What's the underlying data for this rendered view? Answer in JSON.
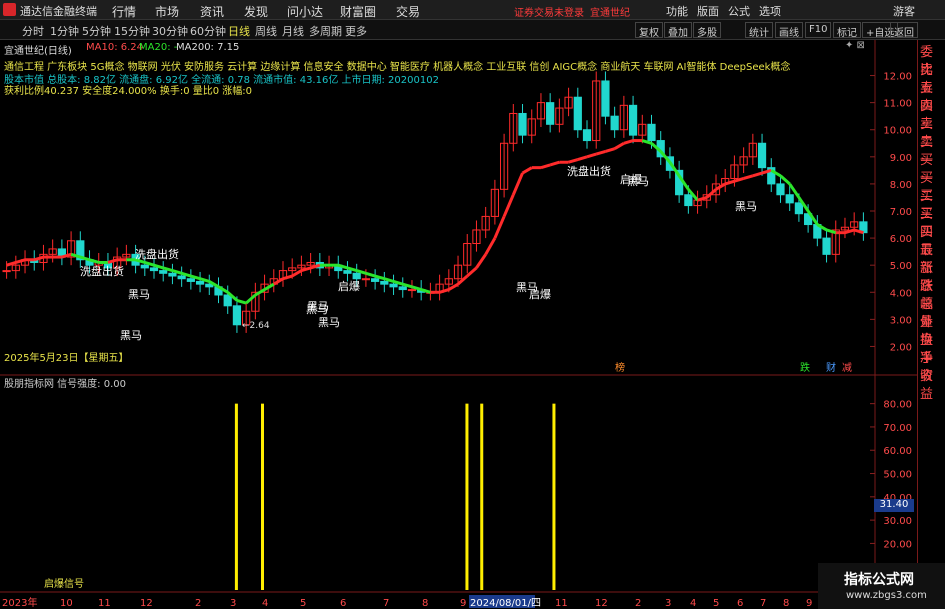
{
  "app": {
    "title": "通达信金融终端"
  },
  "menus": [
    "行情",
    "市场",
    "资讯",
    "发现",
    "问小达",
    "财富圈",
    "交易"
  ],
  "warning": "证券交易未登录",
  "warning2": "宜通世纪",
  "top_right_menus": [
    "功能",
    "版面",
    "公式",
    "选项",
    "游客"
  ],
  "periods": [
    "分时",
    "1分钟",
    "5分钟",
    "15分钟",
    "30分钟",
    "60分钟",
    "日线",
    "周线",
    "月线",
    "多周期",
    "更多"
  ],
  "active_period": "日线",
  "toolbar_right": [
    "复权",
    "叠加",
    "多股",
    "统计",
    "画线",
    "F10",
    "标记",
    "+自选",
    "返回"
  ],
  "info": {
    "stock": "宜通世纪(日线)",
    "ma10": "MA10: 6.24",
    "ma20": "MA20: -",
    "ma200": "MA200: 7.15"
  },
  "concepts": "通信工程  广东板块  5G概念 物联网 光伏 安防服务 云计算 边缘计算 信息安全 数据中心 智能医疗 机器人概念 工业互联 信创 AIGC概念 商业航天 车联网 AI智能体 DeepSeek概念",
  "stats1": "股本市值 总股本: 8.82亿 流通盘: 6.92亿 全流通: 0.78 流通市值: 43.16亿 上市日期: 20200102",
  "stats2": "获利比例40.237  安全度24.000%  换手:0    量比0       涨幅:0",
  "date_label": "2025年5月23日【星期五】",
  "indicator_label": "股朋指标网  信号强度: 0.00",
  "signal_title": "启爆信号",
  "right_box_value": "31.40",
  "side_panel": [
    "委比",
    "卖五",
    "卖四",
    "卖三",
    "卖二",
    "卖一",
    "买一",
    "买二",
    "买三",
    "买四",
    "买五",
    "最新",
    "涨跌",
    "涨幅",
    "总量",
    "外盘",
    "换手",
    "净资",
    "收益"
  ],
  "price_axis": [
    "12.00",
    "11.00",
    "10.00",
    "9.00",
    "8.00",
    "7.00",
    "6.00",
    "5.00",
    "4.00",
    "3.00",
    "2.00"
  ],
  "ind_axis": [
    "80.00",
    "70.00",
    "60.00",
    "50.00",
    "40.00",
    "30.00",
    "20.00",
    "10.00",
    "0.00"
  ],
  "x_axis_labels": [
    "2023年",
    "10",
    "11",
    "12",
    "2",
    "3",
    "4",
    "5",
    "6",
    "7",
    "8",
    "9",
    "2024/08/01/四",
    "11",
    "12",
    "2",
    "3",
    "4",
    "5",
    "6",
    "7",
    "8",
    "9",
    "10",
    "11",
    "12",
    "2",
    "3",
    "4",
    "5"
  ],
  "annotations": [
    {
      "text": "洗盘出货",
      "color": "#ffffff"
    },
    {
      "text": "洗盘出货",
      "color": "#ffffff"
    },
    {
      "text": "黑马",
      "color": "#ffffff"
    },
    {
      "text": "黑马",
      "color": "#ffffff"
    },
    {
      "text": "黑马",
      "color": "#ffffff"
    },
    {
      "text": "黑马",
      "color": "#ffffff"
    },
    {
      "text": "黑马",
      "color": "#ffffff"
    },
    {
      "text": "黑马",
      "color": "#ffffff"
    },
    {
      "text": "启爆",
      "color": "#ffffff"
    },
    {
      "text": "启爆",
      "color": "#ffffff"
    },
    {
      "text": "洗盘出货",
      "color": "#ffffff"
    },
    {
      "text": "黑马",
      "color": "#ffffff"
    },
    {
      "text": "启爆",
      "color": "#ffffff"
    },
    {
      "text": "黑马",
      "color": "#ffffff"
    }
  ],
  "low_marker": "2.64",
  "event_tags": [
    "榜",
    "跌",
    "财",
    "减"
  ],
  "watermark": {
    "line1": "指标公式网",
    "line2": "www.zbgs3.com"
  },
  "chart_data": {
    "type": "line",
    "title": "",
    "price_range": [
      1.5,
      12.5
    ],
    "colors": {
      "up": "#ff2b2b",
      "down": "#21d7ce",
      "ma_up": "#ff2b2b",
      "ma_down": "#2be52b",
      "signal": "#ffee00"
    },
    "ma_series": [
      5.0,
      5.1,
      5.2,
      5.2,
      5.3,
      5.3,
      5.3,
      5.4,
      5.3,
      5.2,
      5.1,
      5.1,
      5.2,
      5.2,
      5.2,
      5.1,
      5.0,
      4.9,
      4.8,
      4.7,
      4.6,
      4.5,
      4.4,
      4.2,
      4.0,
      3.7,
      3.6,
      3.9,
      4.1,
      4.3,
      4.5,
      4.6,
      4.8,
      4.9,
      5.0,
      5.0,
      5.0,
      4.9,
      4.8,
      4.7,
      4.6,
      4.5,
      4.4,
      4.3,
      4.2,
      4.1,
      4.0,
      4.0,
      4.1,
      4.3,
      4.6,
      4.9,
      5.4,
      6.0,
      6.8,
      7.6,
      8.4,
      8.6,
      8.6,
      8.7,
      8.8,
      8.8,
      8.9,
      9.0,
      9.1,
      9.2,
      9.3,
      9.5,
      9.6,
      9.6,
      9.5,
      9.2,
      8.8,
      8.3,
      7.8,
      7.4,
      7.5,
      7.8,
      8.0,
      8.1,
      8.2,
      8.3,
      8.4,
      8.5,
      8.3,
      8.0,
      7.5,
      7.0,
      6.5,
      6.3,
      6.2,
      6.2,
      6.3,
      6.2
    ],
    "ma_color_flags": [
      1,
      1,
      1,
      1,
      1,
      1,
      1,
      1,
      0,
      0,
      0,
      0,
      1,
      1,
      0,
      0,
      0,
      0,
      0,
      0,
      0,
      0,
      0,
      0,
      0,
      0,
      0,
      0,
      0,
      0,
      1,
      1,
      1,
      1,
      1,
      0,
      0,
      0,
      0,
      0,
      0,
      0,
      0,
      0,
      0,
      0,
      0,
      1,
      1,
      1,
      1,
      1,
      1,
      1,
      1,
      1,
      1,
      1,
      1,
      1,
      1,
      1,
      1,
      1,
      1,
      1,
      1,
      1,
      1,
      1,
      0,
      0,
      0,
      0,
      0,
      0,
      1,
      1,
      1,
      1,
      1,
      1,
      1,
      1,
      0,
      0,
      0,
      0,
      0,
      0,
      0,
      1,
      1,
      1
    ],
    "close_series": [
      4.8,
      5.0,
      5.2,
      5.1,
      5.4,
      5.6,
      5.3,
      5.9,
      5.2,
      5.0,
      5.1,
      4.9,
      5.3,
      5.4,
      5.0,
      4.9,
      4.8,
      4.7,
      4.6,
      4.5,
      4.4,
      4.3,
      4.2,
      3.9,
      3.5,
      2.8,
      3.3,
      4.0,
      4.3,
      4.5,
      4.8,
      4.9,
      5.0,
      5.1,
      4.9,
      5.0,
      4.8,
      4.7,
      4.5,
      4.5,
      4.4,
      4.3,
      4.2,
      4.1,
      4.1,
      4.0,
      4.0,
      4.3,
      4.5,
      5.0,
      5.8,
      6.3,
      6.8,
      7.8,
      9.5,
      10.6,
      9.8,
      10.4,
      11.0,
      10.2,
      10.8,
      11.2,
      10.0,
      9.6,
      11.8,
      10.5,
      10.0,
      10.9,
      9.8,
      10.2,
      9.6,
      9.0,
      8.5,
      7.6,
      7.2,
      7.4,
      7.6,
      8.0,
      8.2,
      8.7,
      9.0,
      9.5,
      8.6,
      8.0,
      7.6,
      7.3,
      6.9,
      6.5,
      6.0,
      5.4,
      6.3,
      6.4,
      6.6,
      6.2
    ],
    "signal_positions": [
      0.27,
      0.3,
      0.535,
      0.552,
      0.635
    ],
    "signal_value": 80
  }
}
